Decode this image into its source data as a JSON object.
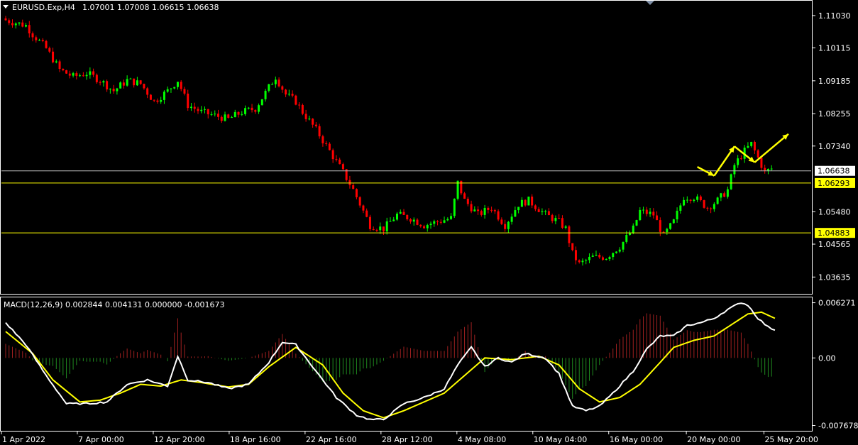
{
  "chart_header": {
    "symbol": "EURUSD.Exp,H4",
    "ohlc": "1.07001 1.07008 1.06615 1.06638",
    "dropdown_icon": "triangle-down-icon"
  },
  "macd_header": "MACD(12,26,9) 0.002844 0.004131 0.000000 -0.001673",
  "colors": {
    "background": "#000000",
    "bull_candle": "#00ff00",
    "bear_candle": "#ff0000",
    "hist_pos": "#a02020",
    "hist_neg": "#1f8a1f",
    "macd_line": "#ffffff",
    "signal_line": "#ffff00",
    "level_line": "#ffff00",
    "price_line": "#c0c0c0",
    "arrow": "#ffff00",
    "tag_bg": "#ffff00",
    "tag_text": "#000000"
  },
  "price_panel": {
    "ylim": [
      1.0318,
      1.1143
    ],
    "ticks": [
      "1.11030",
      "1.10115",
      "1.09185",
      "1.08255",
      "1.07340",
      "1.05480",
      "1.04565",
      "1.03635"
    ],
    "current_price": "1.06638",
    "levels": [
      {
        "value": "1.06293",
        "label": "1.06293"
      },
      {
        "value": "1.04883",
        "label": "1.04883"
      }
    ],
    "projection_arrows": [
      {
        "from_bar": 205,
        "from": 1.0675,
        "to_bar": 210,
        "to": 1.065
      },
      {
        "from_bar": 210,
        "from": 1.065,
        "to_bar": 216,
        "to": 1.0733
      },
      {
        "from_bar": 216,
        "from": 1.0733,
        "to_bar": 222,
        "to": 1.0688
      },
      {
        "from_bar": 222,
        "from": 1.0688,
        "to_bar": 232,
        "to": 1.0768
      }
    ]
  },
  "macd_panel": {
    "ylim": [
      -0.0082,
      0.0068
    ],
    "ticks": [
      "0.006271",
      "0.00",
      "-0.007678"
    ]
  },
  "x_labels": [
    "1 Apr 2022",
    "7 Apr 00:00",
    "12 Apr 20:00",
    "18 Apr 16:00",
    "22 Apr 16:00",
    "28 Apr 12:00",
    "4 May 08:00",
    "10 May 04:00",
    "16 May 00:00",
    "20 May 00:00",
    "25 May 20:00"
  ],
  "chart_data": {
    "type": "candlestick",
    "symbol": "EURUSD.Exp",
    "timeframe": "H4",
    "close_path": [
      [
        0,
        1.109
      ],
      [
        6,
        1.1075
      ],
      [
        8,
        1.105
      ],
      [
        12,
        1.101
      ],
      [
        16,
        1.095
      ],
      [
        20,
        1.093
      ],
      [
        24,
        1.094
      ],
      [
        28,
        1.092
      ],
      [
        32,
        1.089
      ],
      [
        36,
        1.092
      ],
      [
        40,
        1.091
      ],
      [
        44,
        1.086
      ],
      [
        48,
        1.089
      ],
      [
        51,
        1.092
      ],
      [
        54,
        1.085
      ],
      [
        58,
        1.083
      ],
      [
        62,
        1.082
      ],
      [
        66,
        1.081
      ],
      [
        70,
        1.083
      ],
      [
        74,
        1.084
      ],
      [
        78,
        1.09
      ],
      [
        80,
        1.093
      ],
      [
        83,
        1.088
      ],
      [
        86,
        1.086
      ],
      [
        88,
        1.083
      ],
      [
        92,
        1.078
      ],
      [
        96,
        1.072
      ],
      [
        100,
        1.066
      ],
      [
        103,
        1.061
      ],
      [
        106,
        1.055
      ],
      [
        108,
        1.051
      ],
      [
        112,
        1.05
      ],
      [
        116,
        1.054
      ],
      [
        120,
        1.053
      ],
      [
        124,
        1.051
      ],
      [
        128,
        1.052
      ],
      [
        132,
        1.053
      ],
      [
        134,
        1.063
      ],
      [
        136,
        1.058
      ],
      [
        140,
        1.054
      ],
      [
        144,
        1.056
      ],
      [
        148,
        1.051
      ],
      [
        152,
        1.057
      ],
      [
        155,
        1.058
      ],
      [
        160,
        1.054
      ],
      [
        164,
        1.052
      ],
      [
        166,
        1.05
      ],
      [
        168,
        1.043
      ],
      [
        170,
        1.04
      ],
      [
        174,
        1.042
      ],
      [
        178,
        1.042
      ],
      [
        182,
        1.045
      ],
      [
        186,
        1.05
      ],
      [
        188,
        1.055
      ],
      [
        192,
        1.054
      ],
      [
        195,
        1.048
      ],
      [
        198,
        1.052
      ],
      [
        201,
        1.059
      ],
      [
        204,
        1.059
      ],
      [
        208,
        1.056
      ],
      [
        211,
        1.058
      ],
      [
        214,
        1.061
      ],
      [
        216,
        1.068
      ],
      [
        219,
        1.072
      ],
      [
        221,
        1.074
      ],
      [
        223,
        1.07
      ],
      [
        225,
        1.066
      ],
      [
        227,
        1.067
      ]
    ],
    "bars": 228,
    "levels": [
      1.06293,
      1.04883
    ],
    "current_price": 1.06638,
    "macd_params": "12,26,9",
    "macd_values": {
      "main": 0.002844,
      "signal": 0.004131,
      "histogram_zero": 0.0,
      "diff": -0.001673
    },
    "macd_path": [
      [
        0,
        0.004
      ],
      [
        6,
        0.0015
      ],
      [
        12,
        -0.002
      ],
      [
        18,
        -0.0052
      ],
      [
        24,
        -0.0052
      ],
      [
        30,
        -0.005
      ],
      [
        36,
        -0.003
      ],
      [
        42,
        -0.0025
      ],
      [
        48,
        -0.0032
      ],
      [
        51,
        0.0002
      ],
      [
        54,
        -0.0025
      ],
      [
        60,
        -0.0028
      ],
      [
        66,
        -0.0035
      ],
      [
        72,
        -0.003
      ],
      [
        78,
        -0.0005
      ],
      [
        82,
        0.0018
      ],
      [
        86,
        0.0015
      ],
      [
        92,
        -0.0015
      ],
      [
        98,
        -0.0045
      ],
      [
        104,
        -0.0065
      ],
      [
        108,
        -0.007
      ],
      [
        112,
        -0.007
      ],
      [
        118,
        -0.0052
      ],
      [
        124,
        -0.0045
      ],
      [
        130,
        -0.0035
      ],
      [
        134,
        -0.0008
      ],
      [
        138,
        0.0012
      ],
      [
        142,
        -0.001
      ],
      [
        146,
        0.0
      ],
      [
        150,
        -0.0005
      ],
      [
        154,
        0.0005
      ],
      [
        160,
        0.0
      ],
      [
        164,
        -0.0018
      ],
      [
        168,
        -0.0055
      ],
      [
        172,
        -0.006
      ],
      [
        176,
        -0.0055
      ],
      [
        180,
        -0.004
      ],
      [
        186,
        -0.0015
      ],
      [
        190,
        0.001
      ],
      [
        194,
        0.0025
      ],
      [
        198,
        0.0025
      ],
      [
        202,
        0.0037
      ],
      [
        206,
        0.004
      ],
      [
        210,
        0.0045
      ],
      [
        214,
        0.0055
      ],
      [
        218,
        0.0063
      ],
      [
        220,
        0.006
      ],
      [
        223,
        0.0045
      ],
      [
        226,
        0.0035
      ],
      [
        228,
        0.0032
      ]
    ],
    "signal_path": [
      [
        0,
        0.003
      ],
      [
        8,
        0.0005
      ],
      [
        14,
        -0.0025
      ],
      [
        22,
        -0.005
      ],
      [
        28,
        -0.0048
      ],
      [
        34,
        -0.004
      ],
      [
        40,
        -0.003
      ],
      [
        46,
        -0.0032
      ],
      [
        52,
        -0.0025
      ],
      [
        58,
        -0.0028
      ],
      [
        66,
        -0.0033
      ],
      [
        72,
        -0.003
      ],
      [
        78,
        -0.001
      ],
      [
        86,
        0.0012
      ],
      [
        94,
        -0.0008
      ],
      [
        100,
        -0.004
      ],
      [
        106,
        -0.006
      ],
      [
        112,
        -0.0068
      ],
      [
        118,
        -0.006
      ],
      [
        124,
        -0.005
      ],
      [
        130,
        -0.004
      ],
      [
        136,
        -0.002
      ],
      [
        142,
        0.0
      ],
      [
        150,
        -0.0002
      ],
      [
        158,
        0.0002
      ],
      [
        164,
        -0.0008
      ],
      [
        170,
        -0.0035
      ],
      [
        176,
        -0.005
      ],
      [
        182,
        -0.0045
      ],
      [
        188,
        -0.003
      ],
      [
        194,
        -0.0005
      ],
      [
        198,
        0.0012
      ],
      [
        204,
        0.002
      ],
      [
        210,
        0.0025
      ],
      [
        216,
        0.004
      ],
      [
        220,
        0.005
      ],
      [
        224,
        0.0052
      ],
      [
        228,
        0.0045
      ]
    ],
    "xlabel": "",
    "ylabel": ""
  }
}
